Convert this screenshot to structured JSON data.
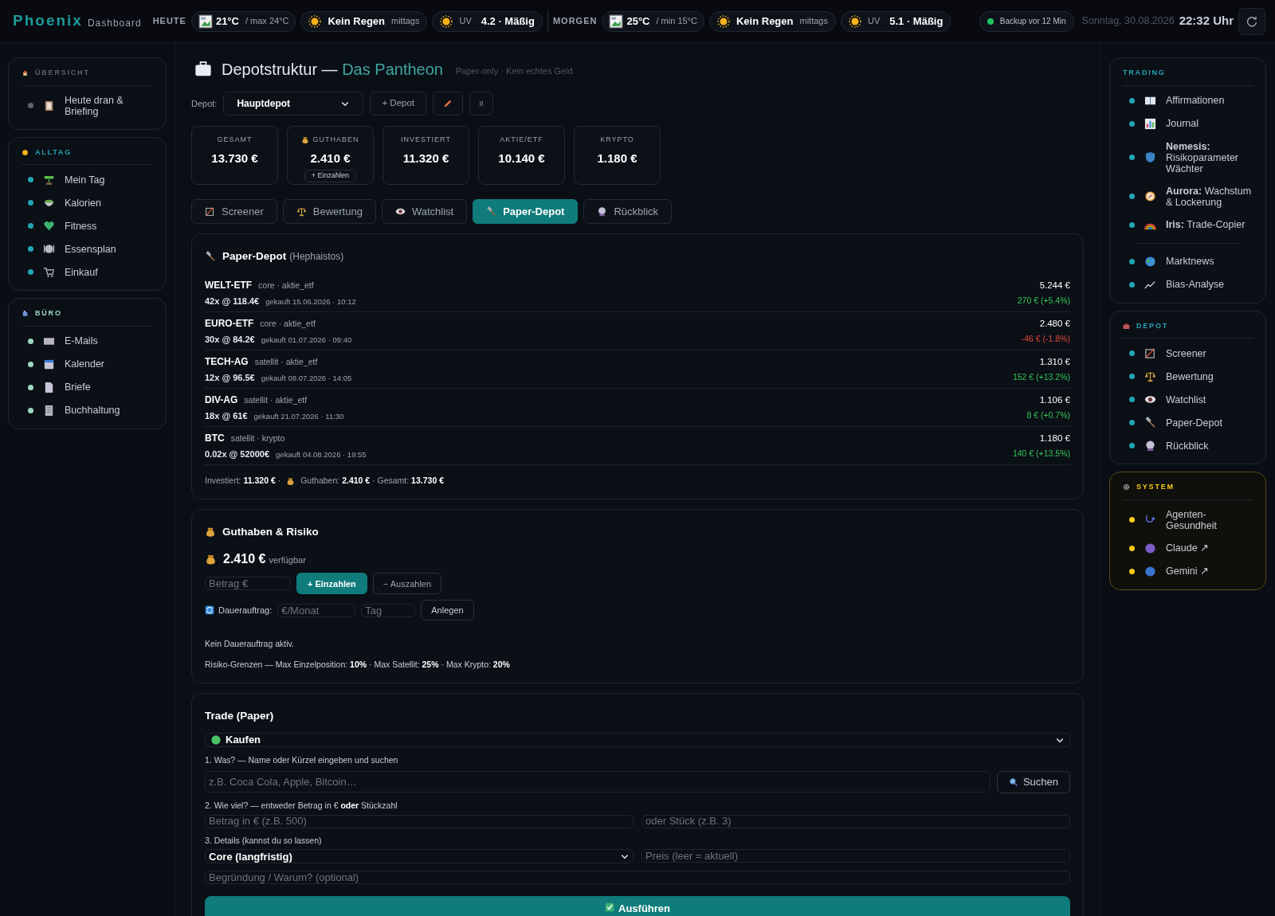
{
  "brand": {
    "name": "Phoenix",
    "subtitle": "Dashboard"
  },
  "weather": [
    {
      "day": "HEUTE",
      "temp": "21°C",
      "temp_range": "/ max 24°C",
      "rain": "Kein Regen",
      "rain_note": "mittags",
      "uv_label": "UV",
      "uv": "4.2 · Mäßig"
    },
    {
      "day": "MORGEN",
      "temp": "25°C",
      "temp_range": "/ min 15°C",
      "rain": "Kein Regen",
      "rain_note": "mittags",
      "uv_label": "UV",
      "uv": "5.1 · Mäßig"
    }
  ],
  "backup": "Backup vor 12 Min",
  "date": "Sonntag, 30.08.2026",
  "time": "22:32 Uhr",
  "left_sidebar": [
    {
      "title": "ÜBERSICHT",
      "color": "#5b6470",
      "groups": [
        [
          {
            "label": "Heute dran & Briefing"
          }
        ]
      ]
    },
    {
      "title": "ALLTAG",
      "color": "#22a6b3",
      "groups": [
        [
          {
            "label": "Mein Tag"
          },
          {
            "label": "Kalorien"
          },
          {
            "label": "Fitness"
          },
          {
            "label": "Essensplan"
          },
          {
            "label": "Einkauf"
          }
        ]
      ]
    },
    {
      "title": "BÜRO",
      "color": "#9ed9c0",
      "groups": [
        [
          {
            "label": "E-Mails"
          },
          {
            "label": "Kalender"
          },
          {
            "label": "Briefe"
          },
          {
            "label": "Buchhaltung"
          }
        ]
      ]
    }
  ],
  "page": {
    "title": "Depotstruktur — ",
    "title_accent": "Das Pantheon",
    "subtitle": "Paper-only · Kein echtes Geld"
  },
  "depot_row": {
    "label": "Depot:",
    "selected_depot": "Hauptdepot",
    "add_button": "+ Depot"
  },
  "stats": [
    {
      "kind": "plain",
      "label": "GESAMT",
      "value": "13.730 €"
    },
    {
      "kind": "cash",
      "label": "GUTHABEN",
      "value": "2.410 €",
      "action": "+ Einzahlen"
    },
    {
      "kind": "plain",
      "label": "INVESTIERT",
      "value": "11.320 €"
    },
    {
      "kind": "plain",
      "label": "AKTIE/ETF",
      "value": "10.140 €"
    },
    {
      "kind": "plain",
      "label": "KRYPTO",
      "value": "1.180 €"
    }
  ],
  "tabs": [
    {
      "label": "Screener",
      "selected": false
    },
    {
      "label": "Bewertung",
      "selected": false
    },
    {
      "label": "Watchlist",
      "selected": false
    },
    {
      "label": "Paper-Depot",
      "selected": true
    },
    {
      "label": "Rückblick",
      "selected": false
    }
  ],
  "paper_depot": {
    "title": "Paper-Depot",
    "title_note": "(Hephaistos)",
    "positions": [
      {
        "name": "WELT-ETF",
        "tags": "core · aktie_etf",
        "qty": "42x @ 118.4€",
        "bought": "gekauft 15.06.2026 · 10:12",
        "value": "5.244 €",
        "change": "270 € (+5.4%)",
        "gain": true
      },
      {
        "name": "EURO-ETF",
        "tags": "core · aktie_etf",
        "qty": "30x @ 84.2€",
        "bought": "gekauft 01.07.2026 · 09:40",
        "value": "2.480 €",
        "change": "-46 € (-1.8%)",
        "gain": false
      },
      {
        "name": "TECH-AG",
        "tags": "satellit · aktie_etf",
        "qty": "12x @ 96.5€",
        "bought": "gekauft 08.07.2026 · 14:05",
        "value": "1.310 €",
        "change": "152 € (+13.2%)",
        "gain": true
      },
      {
        "name": "DIV-AG",
        "tags": "satellit · aktie_etf",
        "qty": "18x @ 61€",
        "bought": "gekauft 21.07.2026 · 11:30",
        "value": "1.106 €",
        "change": "8 € (+0.7%)",
        "gain": true
      },
      {
        "name": "BTC",
        "tags": "satellit · krypto",
        "qty": "0.02x @ 52000€",
        "bought": "gekauft 04.08.2026 · 19:55",
        "value": "1.180 €",
        "change": "140 € (+13.5%)",
        "gain": true
      }
    ],
    "summary_parts": [
      "Investiert: **11.320 €** ·",
      "Guthaben: **2.410 €** · Gesamt: **13.730 €**"
    ]
  },
  "cash_risk": {
    "title": "Guthaben & Risiko",
    "balance": "2.410 €",
    "balance_note": "verfügbar",
    "amount_placeholder": "Betrag €",
    "deposit": "+ Einzahlen",
    "withdraw": "− Auszahlen",
    "standing_label": "Dauerauftrag:",
    "monthly_placeholder": "€/Monat",
    "day_placeholder": "Tag",
    "create": "Anlegen",
    "standing_note": "Kein Dauerauftrag aktiv.",
    "risk": "Risiko-Grenzen — Max Einzelposition: **10%** · Max Satellit: **25%** · Max Krypto: **20%**"
  },
  "trade": {
    "title": "Trade (Paper)",
    "side": "Kaufen",
    "step1": "1. Was? — Name oder Kürzel eingeben und suchen",
    "search_placeholder": "z.B. Coca Cola, Apple, Bitcoin…",
    "search_button": "Suchen",
    "step2": "2. Wie viel? — entweder Betrag in € **oder** Stückzahl",
    "amount_placeholder": "Betrag in € (z.B. 500)",
    "pieces_placeholder": "oder Stück (z.B. 3)",
    "step3": "3. Details (kannst du so lassen)",
    "horizon": "Core (langfristig)",
    "price_placeholder": "Preis (leer = aktuell)",
    "reason_placeholder": "Begründung / Warum? (optional)",
    "submit": "Ausführen"
  },
  "right_sidebar": [
    {
      "title": "TRADING",
      "color": "#22a6b3",
      "groups": [
        [
          {
            "label": "Affirmationen"
          },
          {
            "label": "Journal"
          },
          {
            "label": "**Nemesis:** Risikoparameter Wächter"
          },
          {
            "label": "**Aurora:** Wachstum & Lockerung"
          },
          {
            "label": "**Iris:** Trade-Copier"
          }
        ],
        [
          {
            "label": "Marktnews"
          },
          {
            "label": "Bias-Analyse"
          }
        ]
      ]
    },
    {
      "title": "DEPOT",
      "color": "#22a6b3",
      "groups": [
        [
          {
            "label": "Screener"
          },
          {
            "label": "Bewertung"
          },
          {
            "label": "Watchlist"
          },
          {
            "label": "Paper-Depot"
          },
          {
            "label": "Rückblick"
          }
        ]
      ]
    },
    {
      "title": "SYSTEM",
      "color": "#facc15",
      "groups": [
        [
          {
            "label": "Agenten-Gesundheit"
          },
          {
            "label": "Claude ↗"
          },
          {
            "label": "Gemini ↗"
          }
        ]
      ]
    }
  ]
}
